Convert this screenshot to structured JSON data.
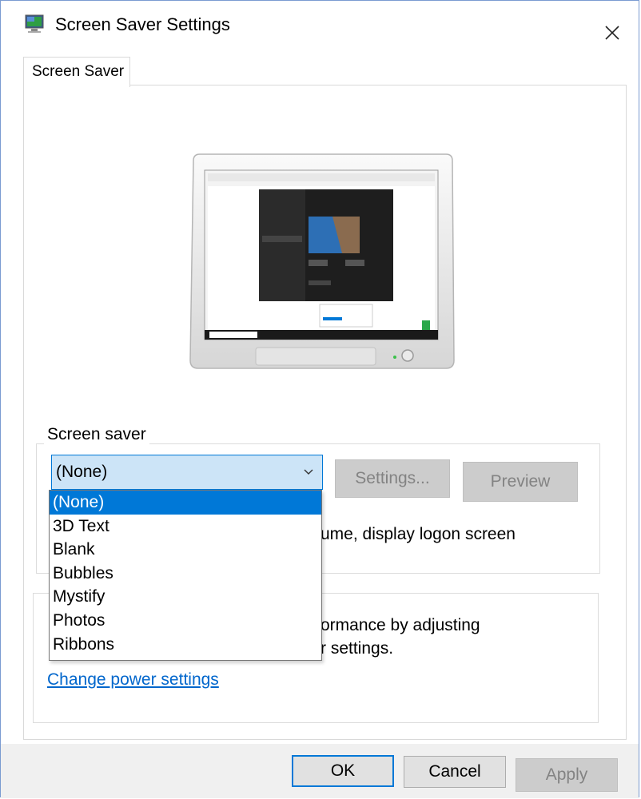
{
  "window": {
    "title": "Screen Saver Settings",
    "icon": "screen-saver-monitor-icon",
    "close_icon": "close-icon"
  },
  "tabs": [
    {
      "label": "Screen Saver",
      "active": true
    }
  ],
  "screen_saver": {
    "group_label": "Screen saver",
    "selected": "(None)",
    "options": [
      "(None)",
      "3D Text",
      "Blank",
      "Bubbles",
      "Mystify",
      "Photos",
      "Ribbons"
    ],
    "settings_button": "Settings...",
    "preview_button": "Preview",
    "resume_text_fragment": "ume, display logon screen"
  },
  "power": {
    "text_line1_fragment": "ormance by adjusting",
    "text_line2_fragment": "r settings.",
    "link": "Change power settings"
  },
  "footer": {
    "ok": "OK",
    "cancel": "Cancel",
    "apply": "Apply"
  },
  "colors": {
    "accent": "#0078d7",
    "combo_bg": "#cce4f7",
    "link": "#0066cc",
    "disabled_button": "#cccccc"
  }
}
